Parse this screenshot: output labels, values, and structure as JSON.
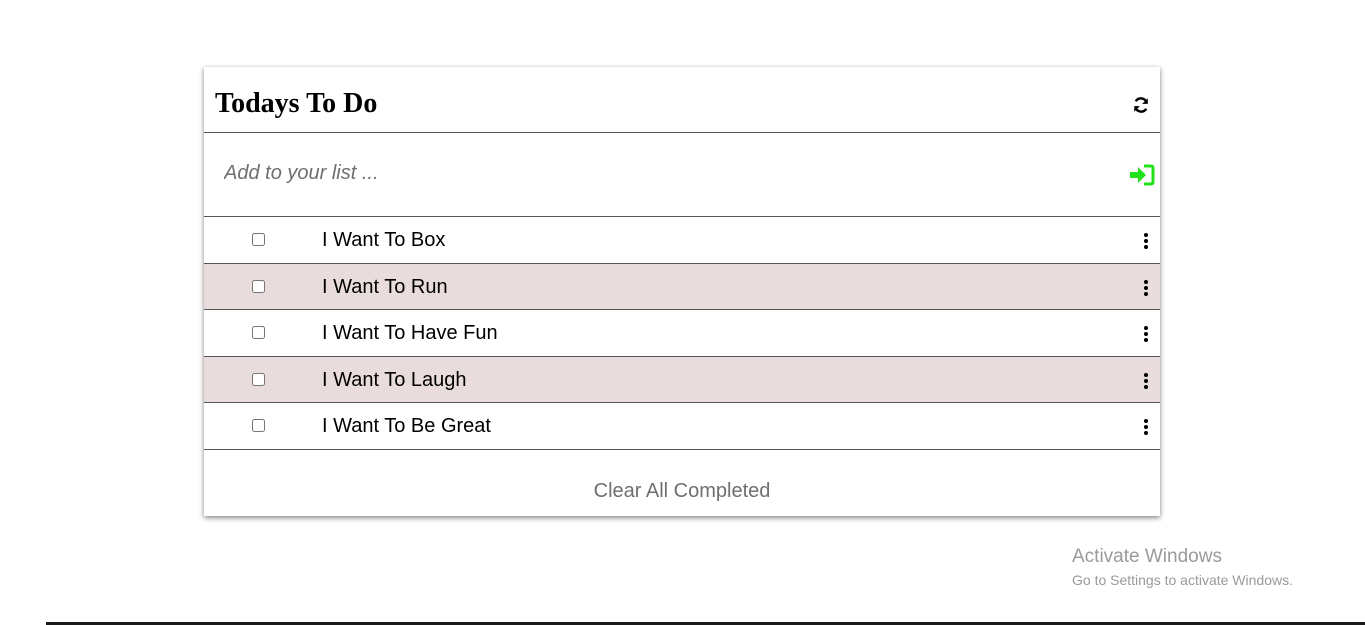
{
  "todo_card": {
    "title": "Todays To Do",
    "refresh_icon": "refresh-icon",
    "add_input": {
      "placeholder": "Add to your list ...",
      "value": ""
    },
    "submit_icon": "sign-in-arrow-icon",
    "submit_icon_color": "#22e01a",
    "items": [
      {
        "label": "I Want To Box",
        "checked": false
      },
      {
        "label": "I Want To Run",
        "checked": false
      },
      {
        "label": "I Want To Have Fun",
        "checked": false
      },
      {
        "label": "I Want To Laugh",
        "checked": false
      },
      {
        "label": "I Want To Be Great",
        "checked": false
      }
    ],
    "alt_row_color": "#e9dcdc",
    "clear_label": "Clear All Completed"
  },
  "watermark": {
    "title": "Activate Windows",
    "subtitle": "Go to Settings to activate Windows."
  }
}
